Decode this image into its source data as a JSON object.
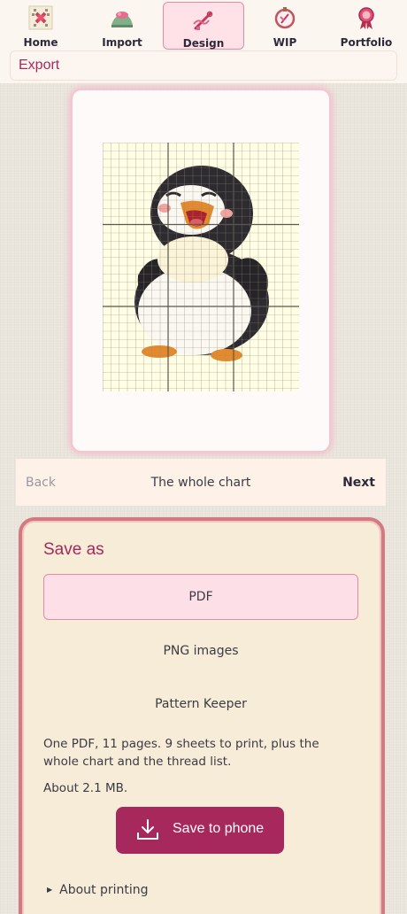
{
  "nav": {
    "tabs": [
      {
        "label": "Home",
        "icon": "cross-stitch-home-icon"
      },
      {
        "label": "Import",
        "icon": "import-hill-icon"
      },
      {
        "label": "Design",
        "icon": "needle-design-icon"
      },
      {
        "label": "WIP",
        "icon": "hoop-wip-icon"
      },
      {
        "label": "Portfolio",
        "icon": "ribbon-award-icon"
      }
    ],
    "active": "Design"
  },
  "header": {
    "title": "Export"
  },
  "preview": {
    "subject_icon": "penguin-pattern-icon"
  },
  "step": {
    "back": "Back",
    "title": "The whole chart",
    "next": "Next"
  },
  "save": {
    "heading": "Save as",
    "options": [
      "PDF",
      "PNG images",
      "Pattern Keeper"
    ],
    "selected": "PDF",
    "description": "One PDF, 11 pages. 9 sheets to print, plus the whole chart and the thread list.",
    "size": "About 2.1 MB.",
    "button": "Save to phone",
    "about": "About printing"
  },
  "colors": {
    "accent": "#a6285c",
    "panel_bg": "#f6ecd8",
    "panel_border": "#d47a7f",
    "selected_bg": "#fde0e7"
  }
}
